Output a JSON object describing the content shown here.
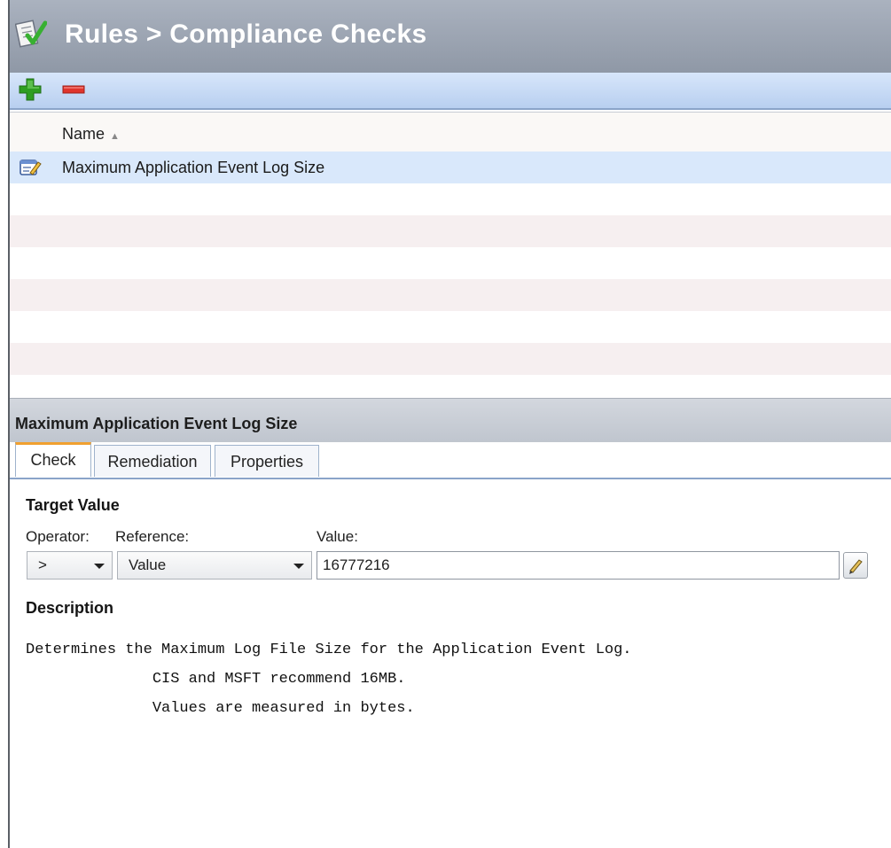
{
  "header": {
    "title": "Rules > Compliance Checks",
    "icon": "compliance-checklist-icon"
  },
  "toolbar": {
    "add_icon": "plus-icon",
    "remove_icon": "minus-icon",
    "add_color": "#2f9e22",
    "remove_color": "#e0342c"
  },
  "grid": {
    "columns": [
      {
        "label": "Name",
        "sorted": true
      }
    ],
    "rows": [
      {
        "name": "Maximum Application Event Log Size",
        "icon": "rule-document-icon",
        "selected": true
      }
    ]
  },
  "detail": {
    "title": "Maximum Application Event Log Size",
    "tabs": [
      {
        "label": "Check",
        "active": true
      },
      {
        "label": "Remediation",
        "active": false
      },
      {
        "label": "Properties",
        "active": false
      }
    ],
    "target_value": {
      "heading": "Target Value",
      "operator_label": "Operator:",
      "reference_label": "Reference:",
      "value_label": "Value:",
      "operator": ">",
      "reference": "Value",
      "value": "16777216",
      "edit_icon": "pencil-icon"
    },
    "description": {
      "heading": "Description",
      "text": "Determines the Maximum Log File Size for the Application Event Log.\n              CIS and MSFT recommend 16MB.\n              Values are measured in bytes."
    }
  }
}
